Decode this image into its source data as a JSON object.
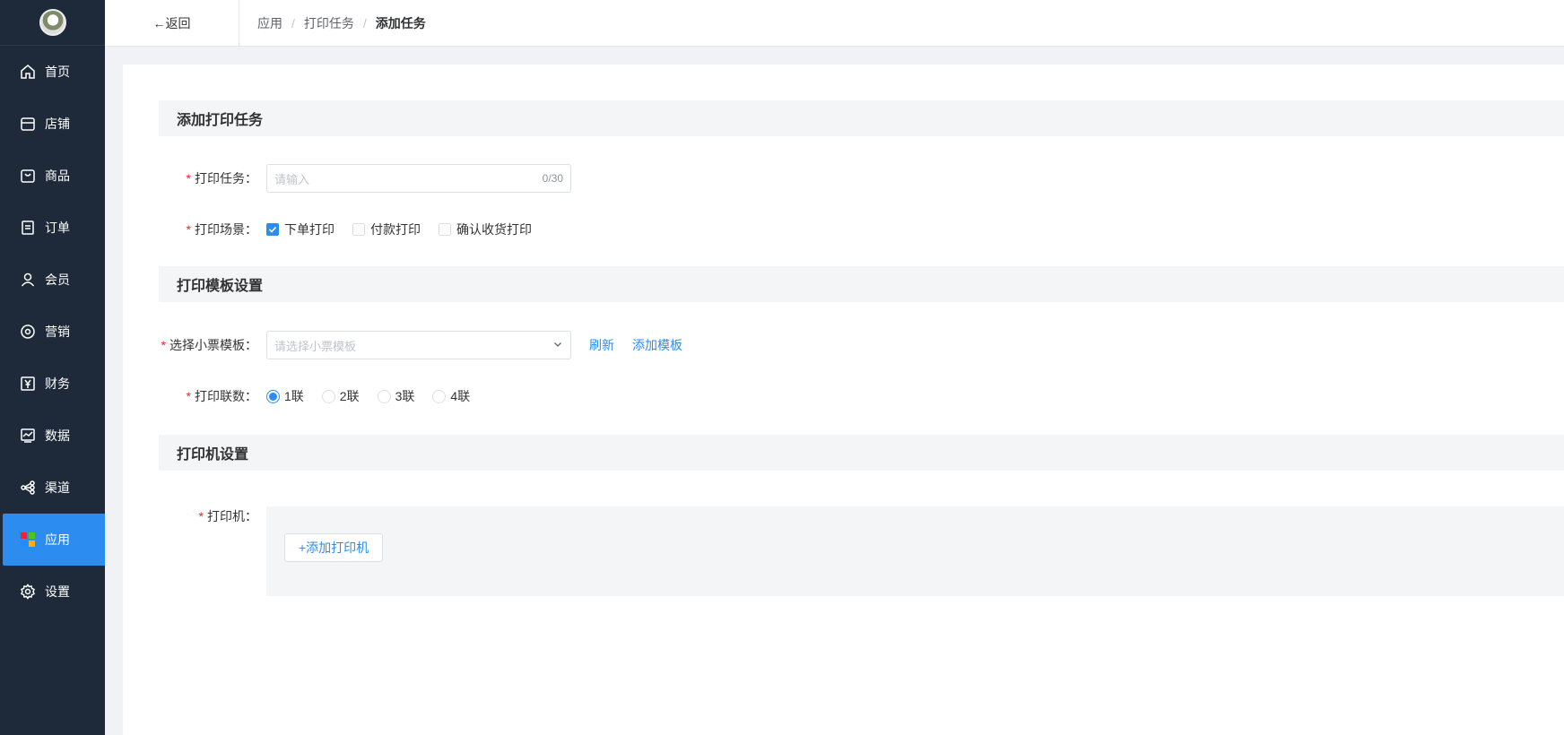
{
  "sidebar": {
    "items": [
      {
        "label": "首页",
        "icon": "home-icon"
      },
      {
        "label": "店铺",
        "icon": "store-icon"
      },
      {
        "label": "商品",
        "icon": "bag-icon"
      },
      {
        "label": "订单",
        "icon": "order-icon"
      },
      {
        "label": "会员",
        "icon": "user-icon"
      },
      {
        "label": "营销",
        "icon": "marketing-icon"
      },
      {
        "label": "财务",
        "icon": "finance-icon"
      },
      {
        "label": "数据",
        "icon": "chart-icon"
      },
      {
        "label": "渠道",
        "icon": "channel-icon"
      },
      {
        "label": "应用",
        "icon": "apps-icon",
        "active": true
      },
      {
        "label": "设置",
        "icon": "settings-icon"
      }
    ]
  },
  "header": {
    "back_label": "返回",
    "breadcrumb": [
      "应用",
      "打印任务",
      "添加任务"
    ],
    "separator": "/"
  },
  "form": {
    "section1_title": "添加打印任务",
    "task_label": "打印任务：",
    "task_placeholder": "请输入",
    "task_count": "0/30",
    "scene_label": "打印场景：",
    "scene_options": [
      {
        "label": "下单打印",
        "checked": true
      },
      {
        "label": "付款打印",
        "checked": false
      },
      {
        "label": "确认收货打印",
        "checked": false
      }
    ],
    "section2_title": "打印模板设置",
    "template_label": "选择小票模板：",
    "template_placeholder": "请选择小票模板",
    "refresh_label": "刷新",
    "add_template_label": "添加模板",
    "copies_label": "打印联数：",
    "copies_options": [
      {
        "label": "1联",
        "checked": true
      },
      {
        "label": "2联",
        "checked": false
      },
      {
        "label": "3联",
        "checked": false
      },
      {
        "label": "4联",
        "checked": false
      }
    ],
    "section3_title": "打印机设置",
    "printer_label": "打印机：",
    "add_printer_label": "+添加打印机"
  },
  "colors": {
    "sidebar_bg": "#1e2a3a",
    "accent": "#2d8cf0",
    "required": "#f5222d"
  }
}
